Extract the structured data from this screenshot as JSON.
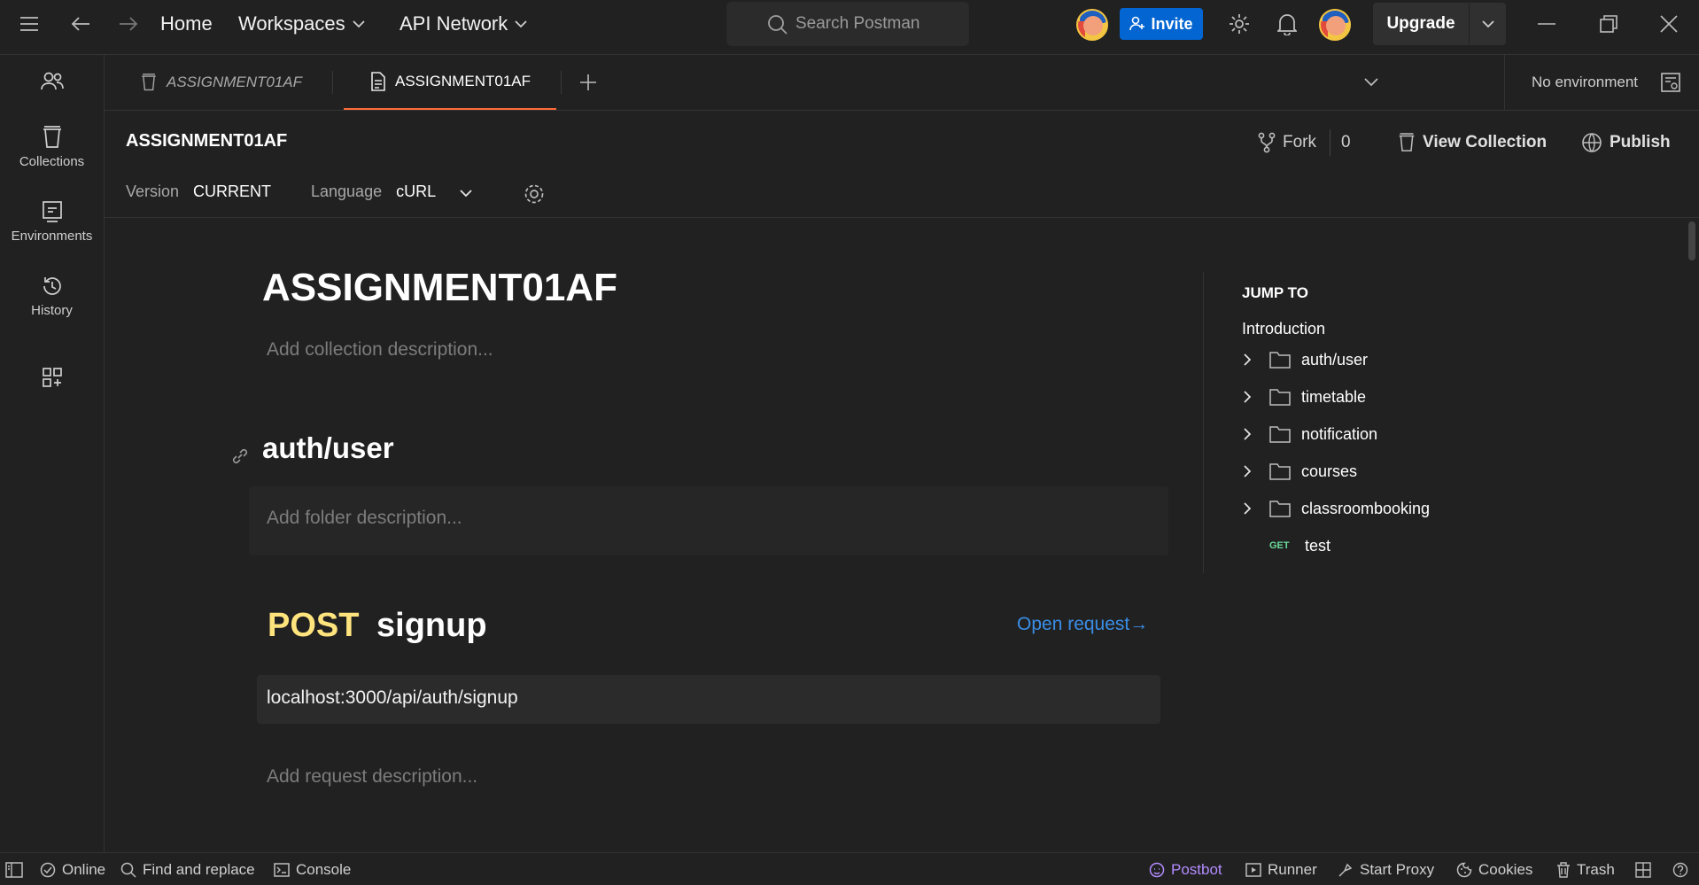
{
  "topbar": {
    "home": "Home",
    "workspaces": "Workspaces",
    "api_network": "API Network",
    "search_placeholder": "Search Postman",
    "invite": "Invite",
    "upgrade": "Upgrade"
  },
  "sidebar": {
    "items": [
      {
        "label": "Collections",
        "icon": "collections-icon"
      },
      {
        "label": "Environments",
        "icon": "environments-icon"
      },
      {
        "label": "History",
        "icon": "history-icon"
      }
    ]
  },
  "tabs": [
    {
      "label": "ASSIGNMENT01AF",
      "state": "inactive"
    },
    {
      "label": "ASSIGNMENT01AF",
      "state": "active"
    }
  ],
  "environment": {
    "selected": "No environment"
  },
  "collection": {
    "title": "ASSIGNMENT01AF",
    "fork_label": "Fork",
    "fork_count": "0",
    "view_collection": "View Collection",
    "publish": "Publish",
    "version_label": "Version",
    "version_value": "CURRENT",
    "language_label": "Language",
    "language_value": "cURL"
  },
  "doc": {
    "heading": "ASSIGNMENT01AF",
    "collection_desc_placeholder": "Add collection description...",
    "folder_heading": "auth/user",
    "folder_desc_placeholder": "Add folder description...",
    "request": {
      "method": "POST",
      "name": "signup",
      "open_request": "Open request→",
      "url": "localhost:3000/api/auth/signup",
      "desc_placeholder": "Add request description..."
    }
  },
  "jump_to": {
    "title": "JUMP TO",
    "intro": "Introduction",
    "folders": [
      "auth/user",
      "timetable",
      "notification",
      "courses",
      "classroombooking"
    ],
    "request": {
      "method": "GET",
      "name": "test"
    }
  },
  "statusbar": {
    "online": "Online",
    "find_replace": "Find and replace",
    "console": "Console",
    "postbot": "Postbot",
    "runner": "Runner",
    "start_proxy": "Start Proxy",
    "cookies": "Cookies",
    "trash": "Trash"
  },
  "colors": {
    "background": "#212121",
    "accent_orange": "#ff6c37",
    "invite_blue": "#0265d2",
    "post_yellow": "#ffe47e",
    "get_green": "#6bdd9a",
    "link_blue": "#3a8ee6",
    "postbot_purple": "#b38cff"
  }
}
